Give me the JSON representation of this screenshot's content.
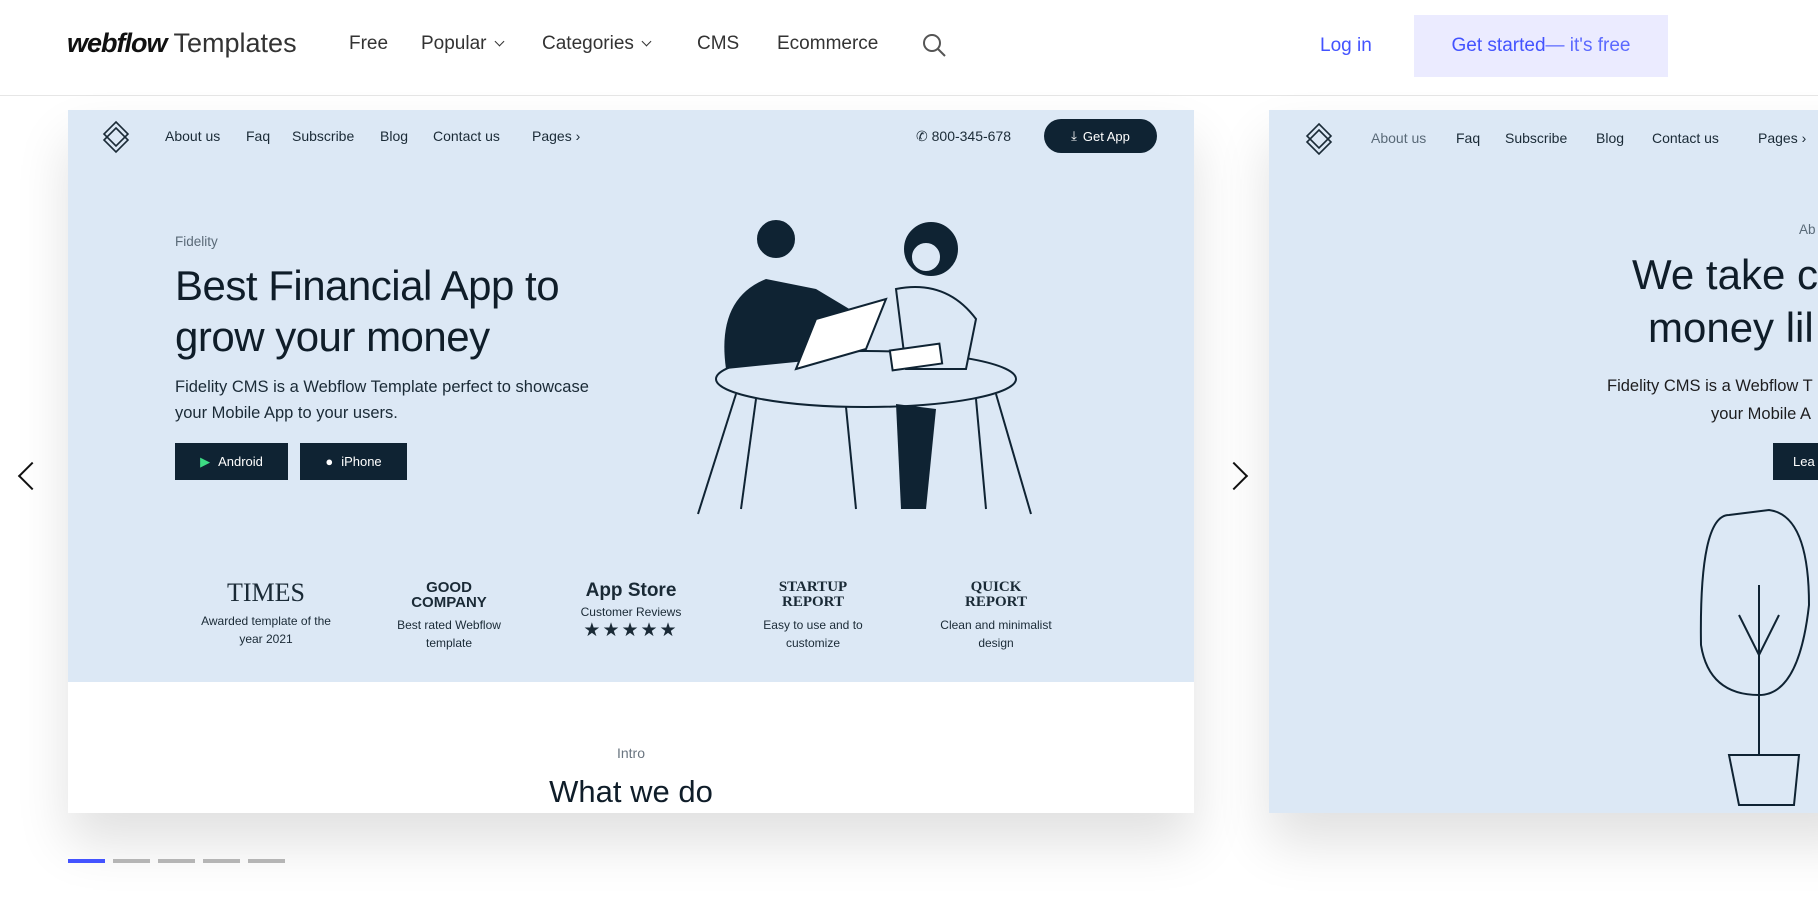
{
  "header": {
    "logo_brand": "webflow",
    "logo_suffix": "Templates",
    "nav": [
      "Free",
      "Popular",
      "Categories",
      "CMS",
      "Ecommerce"
    ],
    "login": "Log in",
    "cta_main": "Get started",
    "cta_sub": " — it's free",
    "accent": "#4353ff"
  },
  "card1": {
    "nav": [
      "About us",
      "Faq",
      "Subscribe",
      "Blog",
      "Contact us",
      "Pages"
    ],
    "phone": "800-345-678",
    "get_app": "Get App",
    "eyebrow": "Fidelity",
    "title_line1": "Best Financial App to",
    "title_line2": "grow your money",
    "para_line1": "Fidelity CMS is a Webflow Template perfect to showcase",
    "para_line2": "your Mobile App to your users.",
    "android": "Android",
    "iphone": "iPhone",
    "badges": [
      {
        "name": "TIMES",
        "desc1": "Awarded template of the",
        "desc2": "year 2021"
      },
      {
        "name": "GOOD COMPANY",
        "desc1": "Best rated Webflow",
        "desc2": "template"
      },
      {
        "name": "App Store",
        "desc1": "Customer Reviews",
        "desc2": "★★★★★"
      },
      {
        "name": "STARTUP REPORT",
        "desc1": "Easy to use and to",
        "desc2": "customize"
      },
      {
        "name": "QUICK REPORT",
        "desc1": "Clean and minimalist",
        "desc2": "design"
      }
    ],
    "intro": "Intro",
    "section_title": "What we do"
  },
  "card2": {
    "nav": [
      "About us",
      "Faq",
      "Subscribe",
      "Blog",
      "Contact us",
      "Pages"
    ],
    "eyebrow": "Ab",
    "title_line1": "We take c",
    "title_line2": "money lil",
    "para_line1": "Fidelity CMS is a Webflow T",
    "para_line2": "your Mobile A",
    "button": "Lea"
  },
  "carousel": {
    "slides": 5,
    "active": 1,
    "active_color": "#4353ff"
  }
}
